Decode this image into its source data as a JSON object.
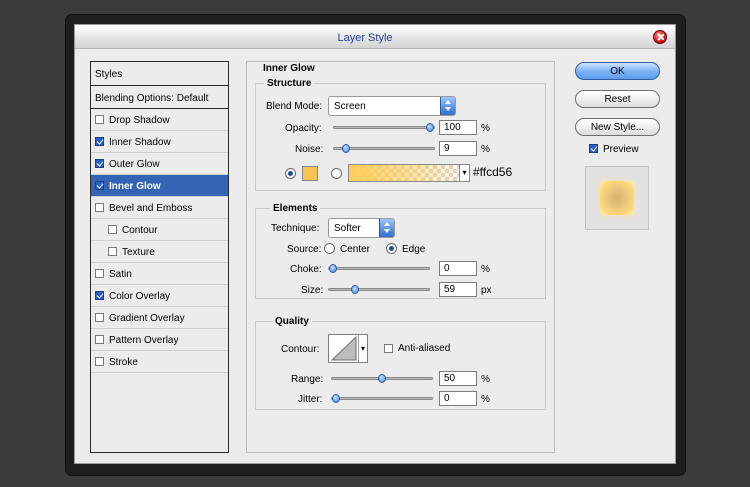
{
  "window": {
    "title": "Layer Style"
  },
  "styles_list": {
    "header": "Styles",
    "blending_options": "Blending Options: Default",
    "items": [
      {
        "label": "Drop Shadow",
        "checked": false,
        "selected": false,
        "sub": false
      },
      {
        "label": "Inner Shadow",
        "checked": true,
        "selected": false,
        "sub": false
      },
      {
        "label": "Outer Glow",
        "checked": true,
        "selected": false,
        "sub": false
      },
      {
        "label": "Inner Glow",
        "checked": true,
        "selected": true,
        "sub": false
      },
      {
        "label": "Bevel and Emboss",
        "checked": false,
        "selected": false,
        "sub": false
      },
      {
        "label": "Contour",
        "checked": false,
        "selected": false,
        "sub": true
      },
      {
        "label": "Texture",
        "checked": false,
        "selected": false,
        "sub": true
      },
      {
        "label": "Satin",
        "checked": false,
        "selected": false,
        "sub": false
      },
      {
        "label": "Color Overlay",
        "checked": true,
        "selected": false,
        "sub": false
      },
      {
        "label": "Gradient Overlay",
        "checked": false,
        "selected": false,
        "sub": false
      },
      {
        "label": "Pattern Overlay",
        "checked": false,
        "selected": false,
        "sub": false
      },
      {
        "label": "Stroke",
        "checked": false,
        "selected": false,
        "sub": false
      }
    ]
  },
  "inner_glow": {
    "title": "Inner Glow",
    "structure": {
      "legend": "Structure",
      "blend_mode_label": "Blend Mode:",
      "blend_mode_value": "Screen",
      "opacity_label": "Opacity:",
      "opacity_value": "100",
      "opacity_fraction": 1.0,
      "opacity_unit": "%",
      "noise_label": "Noise:",
      "noise_value": "9",
      "noise_fraction": 0.09,
      "noise_unit": "%",
      "color_hex": "#ffcd56",
      "color_solid": "#f6c452",
      "color_mode": "solid"
    },
    "elements": {
      "legend": "Elements",
      "technique_label": "Technique:",
      "technique_value": "Softer",
      "source_label": "Source:",
      "source_center": "Center",
      "source_edge": "Edge",
      "source_selected": "edge",
      "choke_label": "Choke:",
      "choke_value": "0",
      "choke_fraction": 0.0,
      "choke_unit": "%",
      "size_label": "Size:",
      "size_value": "59",
      "size_fraction": 0.24,
      "size_unit": "px"
    },
    "quality": {
      "legend": "Quality",
      "contour_label": "Contour:",
      "anti_aliased_label": "Anti-aliased",
      "anti_aliased": false,
      "range_label": "Range:",
      "range_value": "50",
      "range_fraction": 0.5,
      "range_unit": "%",
      "jitter_label": "Jitter:",
      "jitter_value": "0",
      "jitter_fraction": 0.0,
      "jitter_unit": "%"
    }
  },
  "buttons": {
    "ok": "OK",
    "reset": "Reset",
    "new_style": "New Style...",
    "preview_label": "Preview",
    "preview_checked": true
  }
}
